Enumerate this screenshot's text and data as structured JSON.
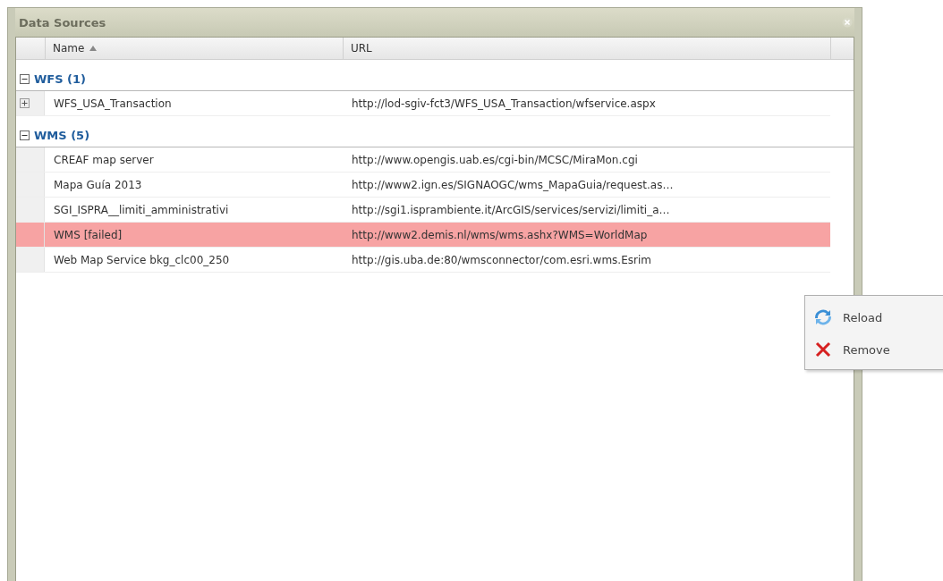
{
  "window": {
    "title": "Data Sources"
  },
  "table": {
    "columns": [
      {
        "label": "Name",
        "sorted": true
      },
      {
        "label": "URL",
        "sorted": false
      }
    ],
    "groups": [
      {
        "label": "WFS (1)",
        "expanded": true,
        "rows": [
          {
            "name": "WFS_USA_Transaction",
            "url": "http://lod-sgiv-fct3/WFS_USA_Transaction/wfservice.aspx",
            "expandable": true,
            "failed": false
          }
        ]
      },
      {
        "label": "WMS (5)",
        "expanded": true,
        "rows": [
          {
            "name": "CREAF map server",
            "url": "http://www.opengis.uab.es/cgi-bin/MCSC/MiraMon.cgi",
            "expandable": false,
            "failed": false
          },
          {
            "name": "Mapa Guía 2013",
            "url": "http://www2.ign.es/SIGNAOGC/wms_MapaGuia/request.as…",
            "expandable": false,
            "failed": false
          },
          {
            "name": "SGI_ISPRA__limiti_amministrativi",
            "url": "http://sgi1.isprambiente.it/ArcGIS/services/servizi/limiti_a…",
            "expandable": false,
            "failed": false
          },
          {
            "name": "WMS [failed]",
            "url": "http://www2.demis.nl/wms/wms.ashx?WMS=WorldMap",
            "expandable": false,
            "failed": true
          },
          {
            "name": "Web Map Service bkg_clc00_250",
            "url": "http://gis.uba.de:80/wmsconnector/com.esri.wms.Esrim",
            "expandable": false,
            "failed": false
          }
        ]
      }
    ]
  },
  "context_menu": {
    "items": [
      {
        "label": "Reload",
        "kind": "reload"
      },
      {
        "label": "Remove",
        "kind": "remove"
      }
    ]
  }
}
